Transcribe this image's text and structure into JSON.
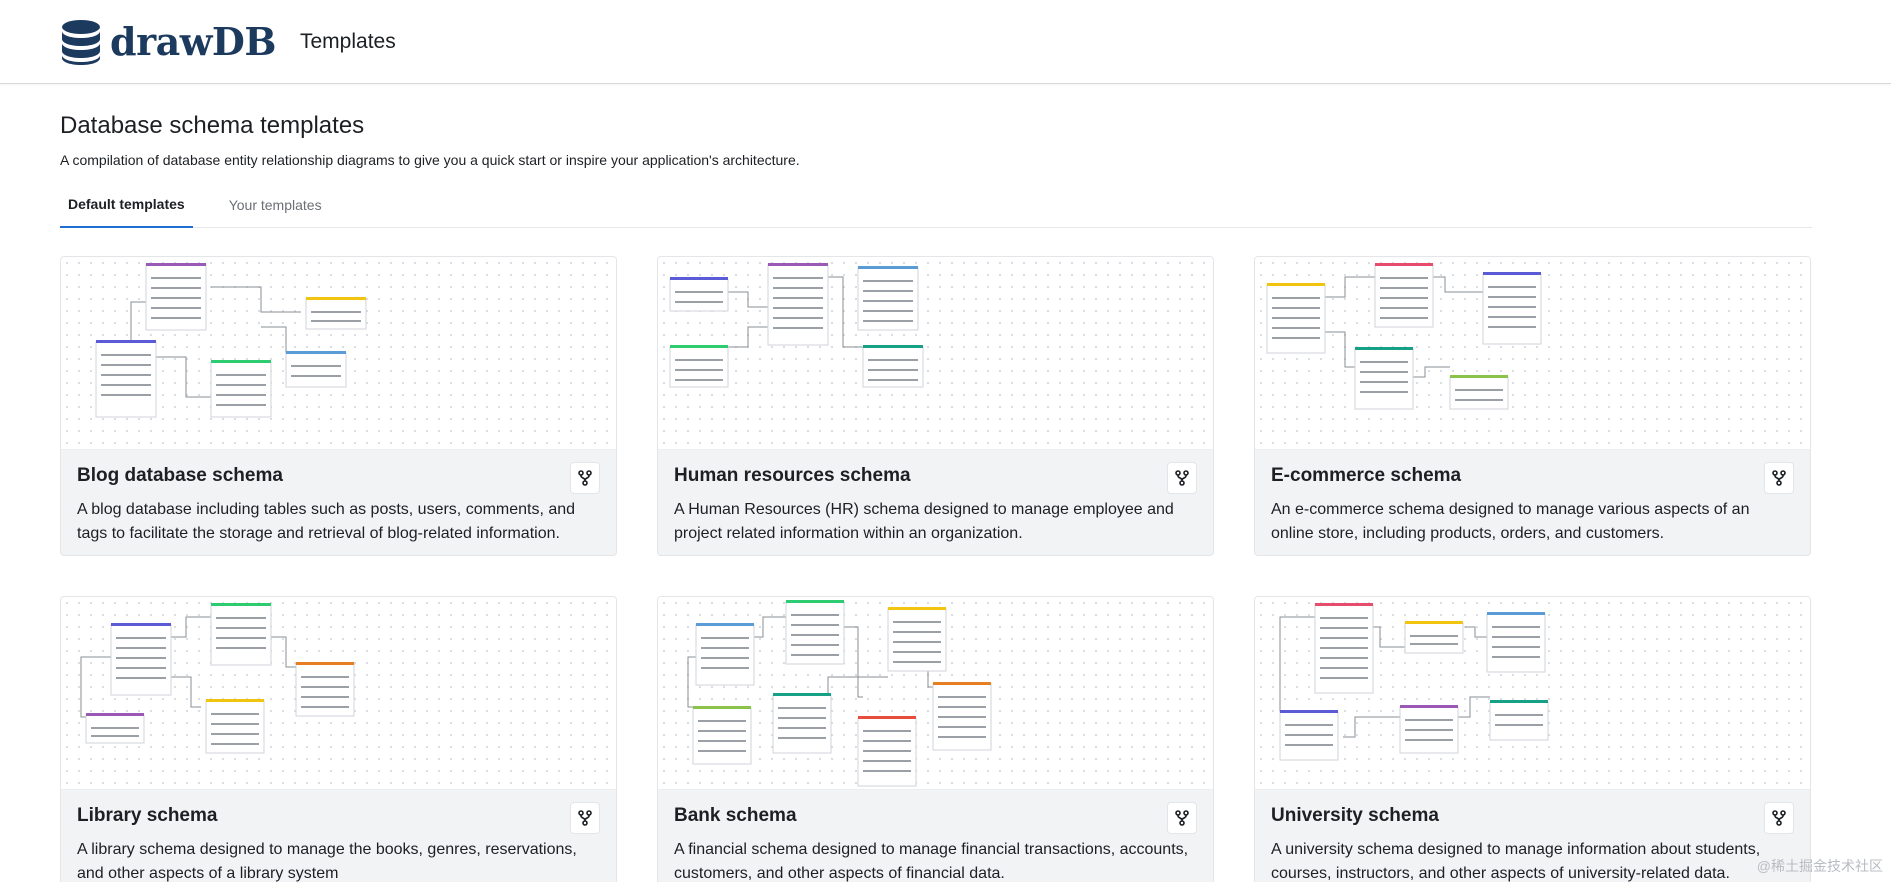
{
  "app": {
    "logo_text": "drawDB",
    "nav_title": "Templates",
    "logo_icon": "database-icon"
  },
  "page": {
    "title": "Database schema templates",
    "subtitle": "A compilation of database entity relationship diagrams to give you a quick start or inspire your application's architecture."
  },
  "tabs": [
    {
      "label": "Default templates",
      "active": true
    },
    {
      "label": "Your templates",
      "active": false
    }
  ],
  "templates": [
    {
      "title": "Blog database schema",
      "description": "A blog database including tables such as posts, users, comments, and tags to facilitate the storage and retrieval of blog-related information.",
      "action_icon": "fork-icon"
    },
    {
      "title": "Human resources schema",
      "description": "A Human Resources (HR) schema designed to manage employee and project related information within an organization.",
      "action_icon": "fork-icon"
    },
    {
      "title": "E-commerce schema",
      "description": "An e-commerce schema designed to manage various aspects of an online store, including products, orders, and customers.",
      "action_icon": "fork-icon"
    },
    {
      "title": "Library schema",
      "description": "A library schema designed to manage the books, genres, reservations, and other aspects of a library system",
      "action_icon": "fork-icon"
    },
    {
      "title": "Bank schema",
      "description": "A financial schema designed to manage financial transactions, accounts, customers, and other aspects of financial data.",
      "action_icon": "fork-icon"
    },
    {
      "title": "University schema",
      "description": "A university schema designed to manage information about students, courses, instructors, and other aspects of university-related data.",
      "action_icon": "fork-icon"
    }
  ],
  "watermark": "@稀土掘金技术社区",
  "colors": {
    "accent": "#1f6fd0",
    "card_bg": "#f2f3f5"
  }
}
